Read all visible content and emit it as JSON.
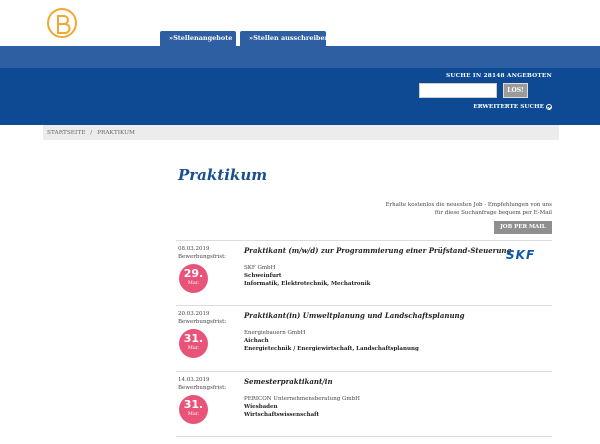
{
  "header": {
    "logo": "logo-b-icon",
    "tabs": [
      {
        "label": "»Stellenangebote"
      },
      {
        "label": "»Stellen ausschreiben"
      }
    ]
  },
  "search": {
    "label": "SUCHE IN 28148 ANGEBOTEN",
    "placeholder": "",
    "value": "",
    "button": "LOS!",
    "advanced": "ERWEITERTE SUCHE",
    "advanced_icon": "chevron-circle-icon"
  },
  "breadcrumb": {
    "home": "STARTSEITE",
    "sep": "/",
    "current": "PRAKTIKUM"
  },
  "page_title": "Praktikum",
  "alert": {
    "text": "Erhalte kostenlos die neuesten Job - Empfehlungen von uns für diese Suchanfrage bequem per E-Mail",
    "button": "JOB PER MAIL"
  },
  "jobs": [
    {
      "date": "08.03.2019",
      "deadline_label": "Bewerbungsfrist:",
      "deadline_day": "29.",
      "deadline_month": "Mar.",
      "title": "Praktikant (m/w/d) zur Programmierung einer Prüfstand-Steuerung",
      "company": "SKF GmbH",
      "city": "Schweinfurt",
      "category": "Informatik, Elektrotechnik, Mechatronik",
      "logo_text": "SKF"
    },
    {
      "date": "20.03.2019",
      "deadline_label": "Bewerbungsfrist:",
      "deadline_day": "31.",
      "deadline_month": "Mar.",
      "title": "Praktikant(in) Umweltplanung und Landschaftsplanung",
      "company": "Energiebauern GmbH",
      "city": "Aichach",
      "category": "Energietechnik / Energiewirtschaft, Landschaftsplanung"
    },
    {
      "date": "14.03.2019",
      "deadline_label": "Bewerbungsfrist:",
      "deadline_day": "31.",
      "deadline_month": "Mar.",
      "title": "Semesterpraktikant/in",
      "company": "PERICON Unternehmensberatung GmbH",
      "city": "Wiesbaden",
      "category": "Wirtschaftswissenschaft"
    }
  ],
  "colors": {
    "brand_blue": "#0d4a93",
    "tab_blue": "#2e5fa3",
    "title_blue": "#1a4f8f",
    "badge_pink": "#e8537a",
    "logo_orange": "#f0a830"
  }
}
